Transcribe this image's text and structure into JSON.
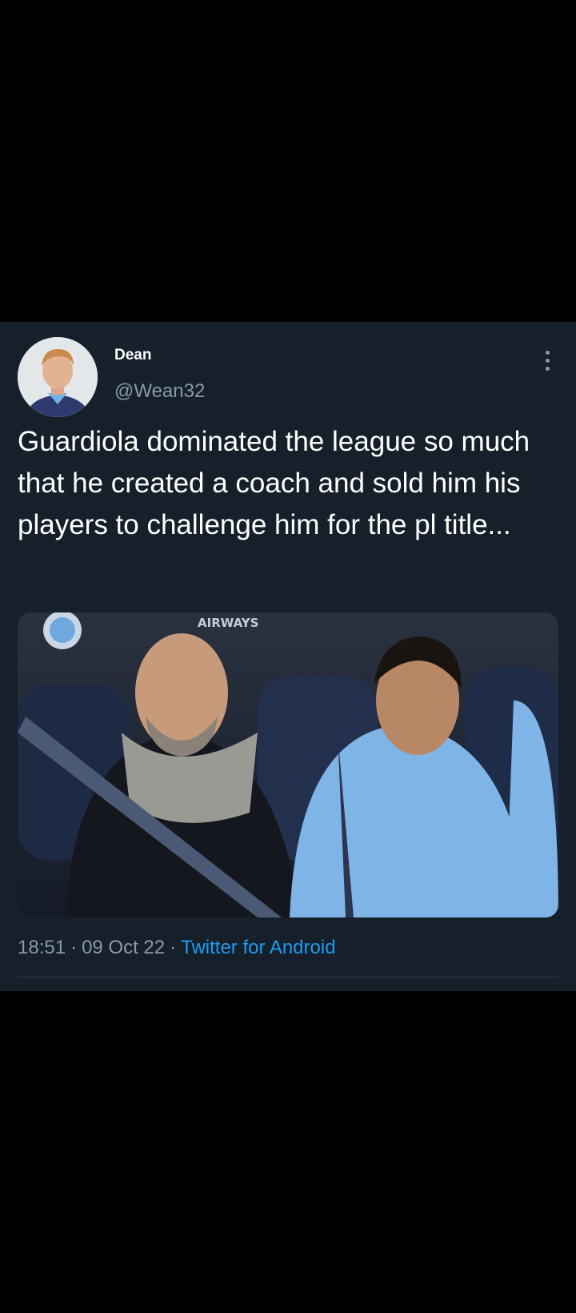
{
  "tweet": {
    "author": {
      "display_name": "Dean",
      "handle": "@Wean32"
    },
    "text": "Guardiola dominated the league so much that he created a coach and sold him his players to challenge him for the pl title...",
    "media": {
      "banner_text": "AIRWAYS"
    },
    "meta": {
      "time": "18:51",
      "separator": "·",
      "date": "09 Oct 22",
      "source": "Twitter for Android"
    }
  },
  "icons": {
    "more": "more-vertical-icon"
  },
  "colors": {
    "background": "#000000",
    "card": "#15202b",
    "text_primary": "#ffffff",
    "text_secondary": "#8b98a5",
    "link": "#1d9bf0"
  }
}
